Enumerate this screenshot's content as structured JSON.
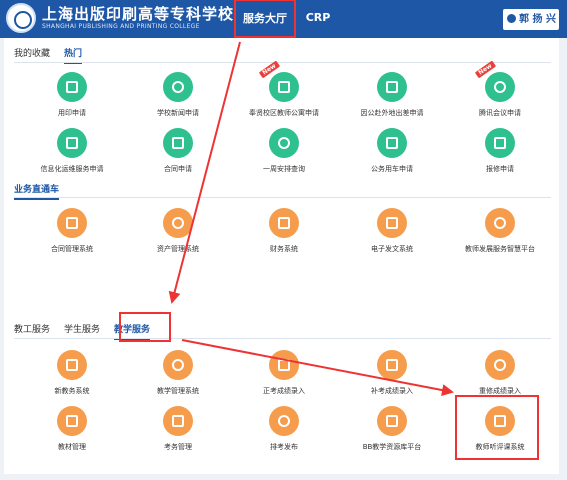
{
  "header": {
    "school_cn": "上海出版印刷高等专科学校",
    "school_en": "SHANGHAI PUBLISHING AND PRINTING COLLEGE",
    "nav": {
      "hall": "服务大厅",
      "crp": "CRP"
    },
    "user": "郭 扬 兴"
  },
  "favorites": {
    "tabs": [
      "我的收藏",
      "热门"
    ],
    "items": [
      {
        "label": "用印申请",
        "color": "green",
        "new": false
      },
      {
        "label": "学校新闻申请",
        "color": "green",
        "new": false
      },
      {
        "label": "奉贤校区教师公寓申请",
        "color": "green",
        "new": true,
        "badge": "New"
      },
      {
        "label": "因公赴外地出差申请",
        "color": "green",
        "new": false
      },
      {
        "label": "腾讯会议申请",
        "color": "green",
        "new": true,
        "badge": "New"
      },
      {
        "label": "信息化运维服务申请",
        "color": "green",
        "new": false
      },
      {
        "label": "合同申请",
        "color": "green",
        "new": false
      },
      {
        "label": "一周安排查询",
        "color": "green",
        "new": false
      },
      {
        "label": "公务用车申请",
        "color": "green",
        "new": false
      },
      {
        "label": "报修申请",
        "color": "green",
        "new": false
      }
    ]
  },
  "direct": {
    "title": "业务直通车",
    "items": [
      {
        "label": "合同管理系统"
      },
      {
        "label": "资产管理系统"
      },
      {
        "label": "财务系统"
      },
      {
        "label": "电子发文系统"
      },
      {
        "label": "教师发展服务智慧平台"
      }
    ]
  },
  "services": {
    "tabs": [
      "教工服务",
      "学生服务",
      "教学服务"
    ],
    "items": [
      {
        "label": "新教务系统"
      },
      {
        "label": "教学管理系统"
      },
      {
        "label": "正考成绩录入"
      },
      {
        "label": "补考成绩录入"
      },
      {
        "label": "重修成绩录入"
      },
      {
        "label": "教材管理"
      },
      {
        "label": "考务管理"
      },
      {
        "label": "排考发布"
      },
      {
        "label": "BB教学资源库平台"
      },
      {
        "label": "教师听评课系统"
      }
    ]
  },
  "colors": {
    "brand": "#1e57a6",
    "green": "#2ec08e",
    "orange": "#f59d4c",
    "highlight": "#e33"
  }
}
